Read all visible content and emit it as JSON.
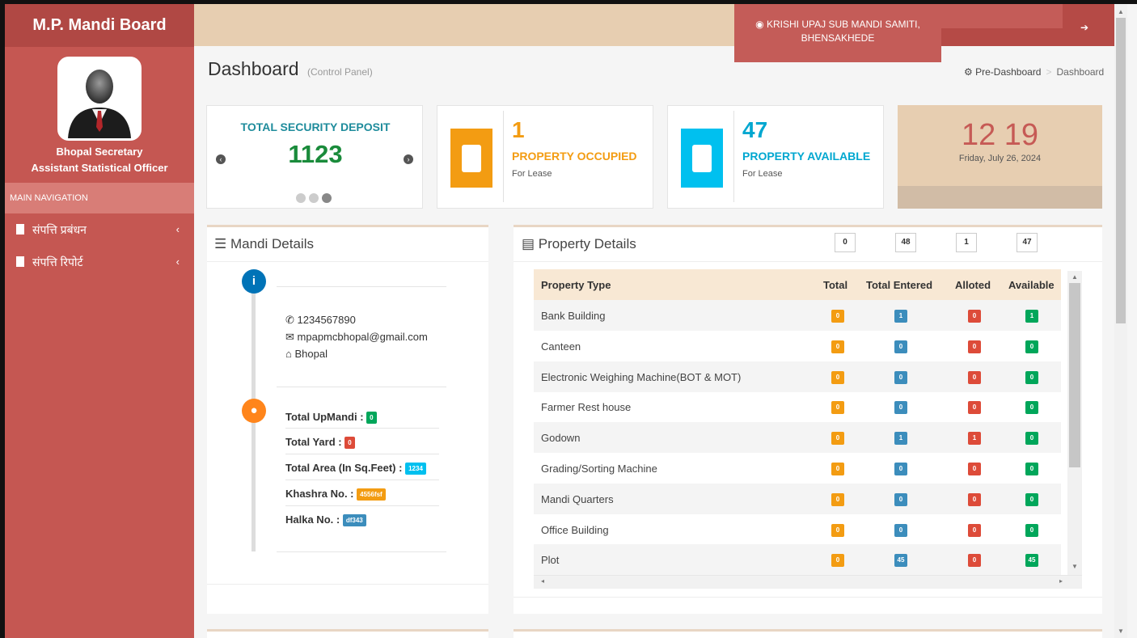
{
  "app": {
    "brand": "M.P. Mandi Board",
    "user_name": "Bhopal Secretary",
    "user_role": "Assistant Statistical Officer",
    "nav_header": "MAIN NAVIGATION",
    "nav_items": [
      {
        "label": "संपत्ति प्रबंधन"
      },
      {
        "label": "संपत्ति रिपोर्ट"
      }
    ]
  },
  "topbar": {
    "mandi_line1": "KRISHI UPAJ SUB MANDI SAMITI,",
    "mandi_line2": "BHENSAKHEDE"
  },
  "header": {
    "title": "Dashboard",
    "subtitle": "(Control Panel)",
    "breadcrumb_home": "Pre-Dashboard",
    "breadcrumb_sep": ">",
    "breadcrumb_current": "Dashboard"
  },
  "stats": {
    "security_title": "TOTAL SECURITY DEPOSIT",
    "security_value": "1123",
    "occupied_value": "1",
    "occupied_label": "PROPERTY OCCUPIED",
    "occupied_sub": "For Lease",
    "available_value": "47",
    "available_label": "PROPERTY AVAILABLE",
    "available_sub": "For Lease",
    "clock_time": "12 19",
    "clock_date": "Friday, July 26, 2024",
    "colors": {
      "orange": "#f39c12",
      "cyan": "#00c0ef",
      "green": "#1a8b3b",
      "red": "#dd4b39",
      "blue": "#3c8dbc"
    }
  },
  "mandi": {
    "title": "Mandi Details",
    "phone": "1234567890",
    "email": "mpapmcbhopal@gmail.com",
    "city": "Bhopal",
    "upmandi_label": "Total UpMandi :",
    "upmandi_value": "0",
    "yard_label": "Total Yard :",
    "yard_value": "0",
    "area_label": "Total Area (In Sq.Feet) :",
    "area_value": "1234",
    "khashra_label": "Khashra No. :",
    "khashra_value": "4556fsf",
    "halka_label": "Halka No. :",
    "halka_value": "df343"
  },
  "property": {
    "title": "Property Details",
    "counts": [
      "0",
      "48",
      "1",
      "47"
    ],
    "headers": [
      "Property Type",
      "Total",
      "Total Entered",
      "Alloted",
      "Available"
    ],
    "rows": [
      {
        "name": "Bank Building",
        "total": "0",
        "entered": "1",
        "alloted": "0",
        "available": "1"
      },
      {
        "name": "Canteen",
        "total": "0",
        "entered": "0",
        "alloted": "0",
        "available": "0"
      },
      {
        "name": "Electronic Weighing Machine(BOT & MOT)",
        "total": "0",
        "entered": "0",
        "alloted": "0",
        "available": "0"
      },
      {
        "name": "Farmer Rest house",
        "total": "0",
        "entered": "0",
        "alloted": "0",
        "available": "0"
      },
      {
        "name": "Godown",
        "total": "0",
        "entered": "1",
        "alloted": "1",
        "available": "0"
      },
      {
        "name": "Grading/Sorting Machine",
        "total": "0",
        "entered": "0",
        "alloted": "0",
        "available": "0"
      },
      {
        "name": "Mandi Quarters",
        "total": "0",
        "entered": "0",
        "alloted": "0",
        "available": "0"
      },
      {
        "name": "Office Building",
        "total": "0",
        "entered": "0",
        "alloted": "0",
        "available": "0"
      },
      {
        "name": "Plot",
        "total": "0",
        "entered": "45",
        "alloted": "0",
        "available": "45"
      }
    ]
  }
}
